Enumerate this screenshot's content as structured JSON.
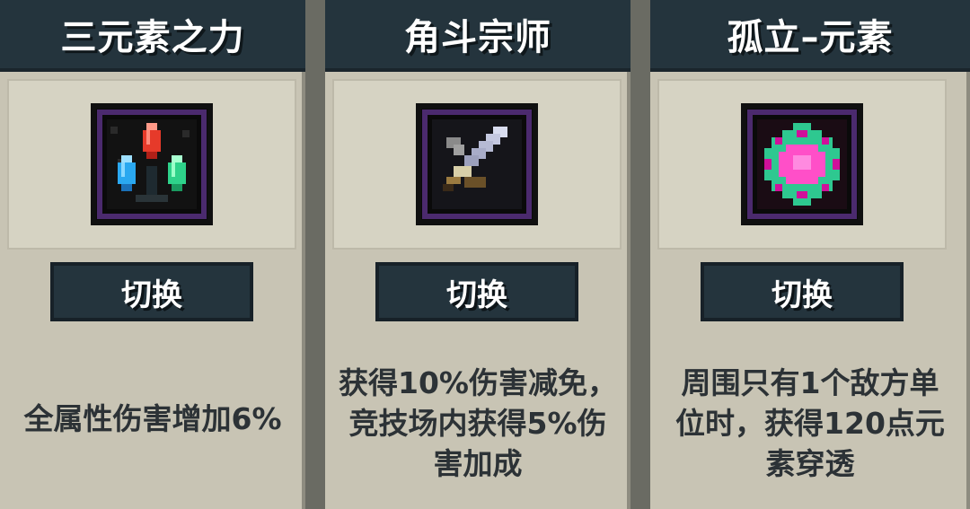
{
  "cards": [
    {
      "title": "三元素之力",
      "button_label": "切换",
      "icon": "three-elements-gems-icon",
      "description": "全属性伤害增加6%"
    },
    {
      "title": "角斗宗师",
      "button_label": "切换",
      "icon": "gladiator-sword-icon",
      "description": "获得10%伤害减免，\n竞技场内获得5%伤\n害加成"
    },
    {
      "title": "孤立–元素",
      "button_label": "切换",
      "icon": "isolated-element-crystal-icon",
      "description": "周围只有1个敌方单\n位时，获得120点元\n素穿透"
    }
  ],
  "colors": {
    "header": "#24343d",
    "card_background": "#c8c4b4",
    "panel_background": "#d6d3c3",
    "text": "#2c3236",
    "icon_border": "#4b2a6e"
  }
}
